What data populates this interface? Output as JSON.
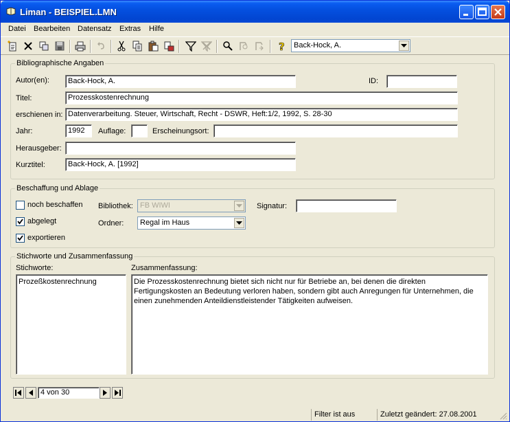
{
  "window": {
    "app_name": "Liman",
    "file_name": "BEISPIEL.LMN",
    "title": "Liman - BEISPIEL.LMN"
  },
  "menu": [
    "Datei",
    "Bearbeiten",
    "Datensatz",
    "Extras",
    "Hilfe"
  ],
  "toolbar": {
    "record_combo_value": "Back-Hock, A."
  },
  "biblio": {
    "group_title": "Bibliographische Angaben",
    "autor_label": "Autor(en):",
    "autor_value": "Back-Hock, A.",
    "id_label": "ID:",
    "id_value": "",
    "titel_label": "Titel:",
    "titel_value": "Prozesskostenrechnung",
    "erschienen_label": "erschienen in:",
    "erschienen_value": "Datenverarbeitung. Steuer, Wirtschaft, Recht - DSWR, Heft:1/2, 1992, S. 28-30",
    "jahr_label": "Jahr:",
    "jahr_value": "1992",
    "auflage_label": "Auflage:",
    "auflage_value": "",
    "ort_label": "Erscheinungsort:",
    "ort_value": "",
    "herausgeber_label": "Herausgeber:",
    "herausgeber_value": "",
    "kurztitel_label": "Kurztitel:",
    "kurztitel_value": "Back-Hock, A. [1992]"
  },
  "beschaffung": {
    "group_title": "Beschaffung und Ablage",
    "noch_beschaffen_label": "noch beschaffen",
    "noch_beschaffen_checked": false,
    "abgelegt_label": "abgelegt",
    "abgelegt_checked": true,
    "exportieren_label": "exportieren",
    "exportieren_checked": true,
    "bibliothek_label": "Bibliothek:",
    "bibliothek_value": "FB WIWI",
    "ordner_label": "Ordner:",
    "ordner_value": "Regal im Haus",
    "signatur_label": "Signatur:",
    "signatur_value": ""
  },
  "stichworte": {
    "group_title": "Stichworte und Zusammenfassung",
    "stichworte_label": "Stichworte:",
    "stichworte_value": "Prozeßkostenrechnung",
    "zusammenfassung_label": "Zusammenfassung:",
    "zusammenfassung_value": "Die Prozesskostenrechnung bietet sich nicht nur für Betriebe an, bei denen die direkten Fertigungskosten an Bedeutung verloren haben, sondern gibt auch Anregungen für Unternehmen, die einen zunehmenden Anteildienstleistender Tätigkeiten aufweisen."
  },
  "navigation": {
    "position": "4 von 30"
  },
  "status": {
    "filter": "Filter ist aus",
    "changed": "Zuletzt geändert: 27.08.2001"
  },
  "colors": {
    "titlebar": "#0450e0",
    "face": "#ece9d8",
    "accent_yellow": "#ffd800"
  }
}
